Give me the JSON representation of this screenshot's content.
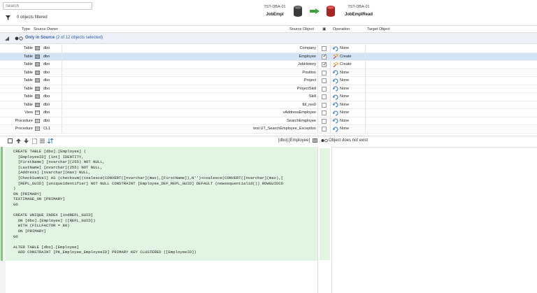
{
  "search": {
    "placeholder": "Search",
    "value": ""
  },
  "filter": {
    "label": "0 objects filtered"
  },
  "source": {
    "server": "TST-DBA-01",
    "database": "JobEmpl",
    "icon": "database-gray-icon"
  },
  "target": {
    "server": "TST-DBA-01",
    "database": "JobEmplRead",
    "icon": "database-red-icon"
  },
  "columns": {
    "type": "Type",
    "source_owner": "Source Owner",
    "source_object": "Source Object",
    "operation": "Operation",
    "target_object": "Target Object"
  },
  "group": {
    "title": "Only in Source",
    "detail": "(2 of 12 objects selected)"
  },
  "rows": [
    {
      "type": "Table",
      "owner": "dbo",
      "object": "Company",
      "checked": false,
      "operation": "None",
      "selected": false
    },
    {
      "type": "Table",
      "owner": "dbo",
      "object": "Employee",
      "checked": true,
      "operation": "Create",
      "selected": true
    },
    {
      "type": "Table",
      "owner": "dbo",
      "object": "JobHistory",
      "checked": true,
      "operation": "Create",
      "selected": false
    },
    {
      "type": "Table",
      "owner": "dbo",
      "object": "Position",
      "checked": false,
      "operation": "None",
      "selected": false
    },
    {
      "type": "Table",
      "owner": "dbo",
      "object": "Project",
      "checked": false,
      "operation": "None",
      "selected": false
    },
    {
      "type": "Table",
      "owner": "dbo",
      "object": "ProjectSkill",
      "checked": false,
      "operation": "None",
      "selected": false
    },
    {
      "type": "Table",
      "owner": "dbo",
      "object": "Skill",
      "checked": false,
      "operation": "None",
      "selected": false
    },
    {
      "type": "Table",
      "owner": "dbo",
      "object": "tbl_res0",
      "checked": false,
      "operation": "None",
      "selected": false
    },
    {
      "type": "View",
      "owner": "dbo",
      "object": "vAddressEmployee",
      "checked": false,
      "operation": "None",
      "selected": false
    },
    {
      "type": "Procedure",
      "owner": "dbo",
      "object": "SearchEmployee",
      "checked": false,
      "operation": "None",
      "selected": false
    },
    {
      "type": "Procedure",
      "owner": "CL1",
      "object": "test UT_SearchEmployee_Exception",
      "checked": false,
      "operation": "None",
      "selected": false
    }
  ],
  "toolbar": {
    "left_object": "[dbo].[Employee]",
    "right_status": "Object does not exist"
  },
  "code": "CREATE TABLE [dbo].[Employee] (\n  [EmployeeID] [int] IDENTITY,\n  [FirstName] [nvarchar](255) NOT NULL,\n  [LastName] [nvarchar](255) NOT NULL,\n  [Address] [nvarchar](max) NULL,\n  [CheckSumVal] AS (checksum((coalesce(CONVERT([nvarchar](max),[FirstName]),N'')+coalesce(CONVERT([nvarchar](max),[\n  [REPL_GUID] [uniqueidentifier] NOT NULL CONSTRAINT [Employee_DEF_REPL_GUID] DEFAULT (newsequentialid()) ROWGUIDCO\n)\nON [PRIMARY]\nTEXTIMAGE_ON [PRIMARY]\nGO\n\nCREATE UNIQUE INDEX [indREPL_GUID]\n  ON [dbo].[Employee] ([REPL_GUID])\n  WITH (FILLFACTOR = 80)\n  ON [PRIMARY]\nGO\n\nALTER TABLE [dbo].[Employee]\n  ADD CONSTRAINT [PK_Employee_EmployeeID] PRIMARY KEY CLUSTERED ([EmployeeID])",
  "colors": {
    "selected_row": "#d3e4f6",
    "code_added_bg": "#e2f4e2",
    "group_text": "#3060b0"
  }
}
